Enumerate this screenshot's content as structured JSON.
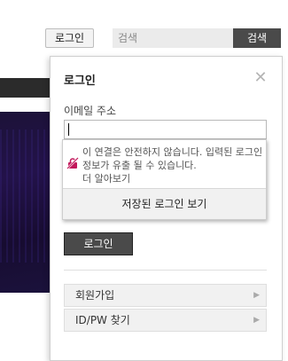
{
  "header": {
    "login_label": "로그인",
    "search_placeholder": "검색",
    "search_button_label": "검색"
  },
  "popup": {
    "title": "로그인",
    "close_icon": "close-icon",
    "email_label": "이메일 주소",
    "email_value": "",
    "autofill": {
      "warning_icon": "insecure-lock-icon",
      "warning_text": "이 연결은 안전하지 않습니다. 입력된 로그인 정보가 유출 될 수 있습니다.",
      "learn_more": "더 알아보기",
      "saved_logins_label": "저장된 로그인 보기"
    },
    "login_button_label": "로그인",
    "links": [
      {
        "label": "회원가입",
        "icon": "chevron-right-icon"
      },
      {
        "label": "ID/PW 찾기",
        "icon": "chevron-right-icon"
      }
    ]
  },
  "colors": {
    "dark_button": "#4a4a4a",
    "warning_icon": "#c2185b",
    "background_image": "#1c1238"
  }
}
